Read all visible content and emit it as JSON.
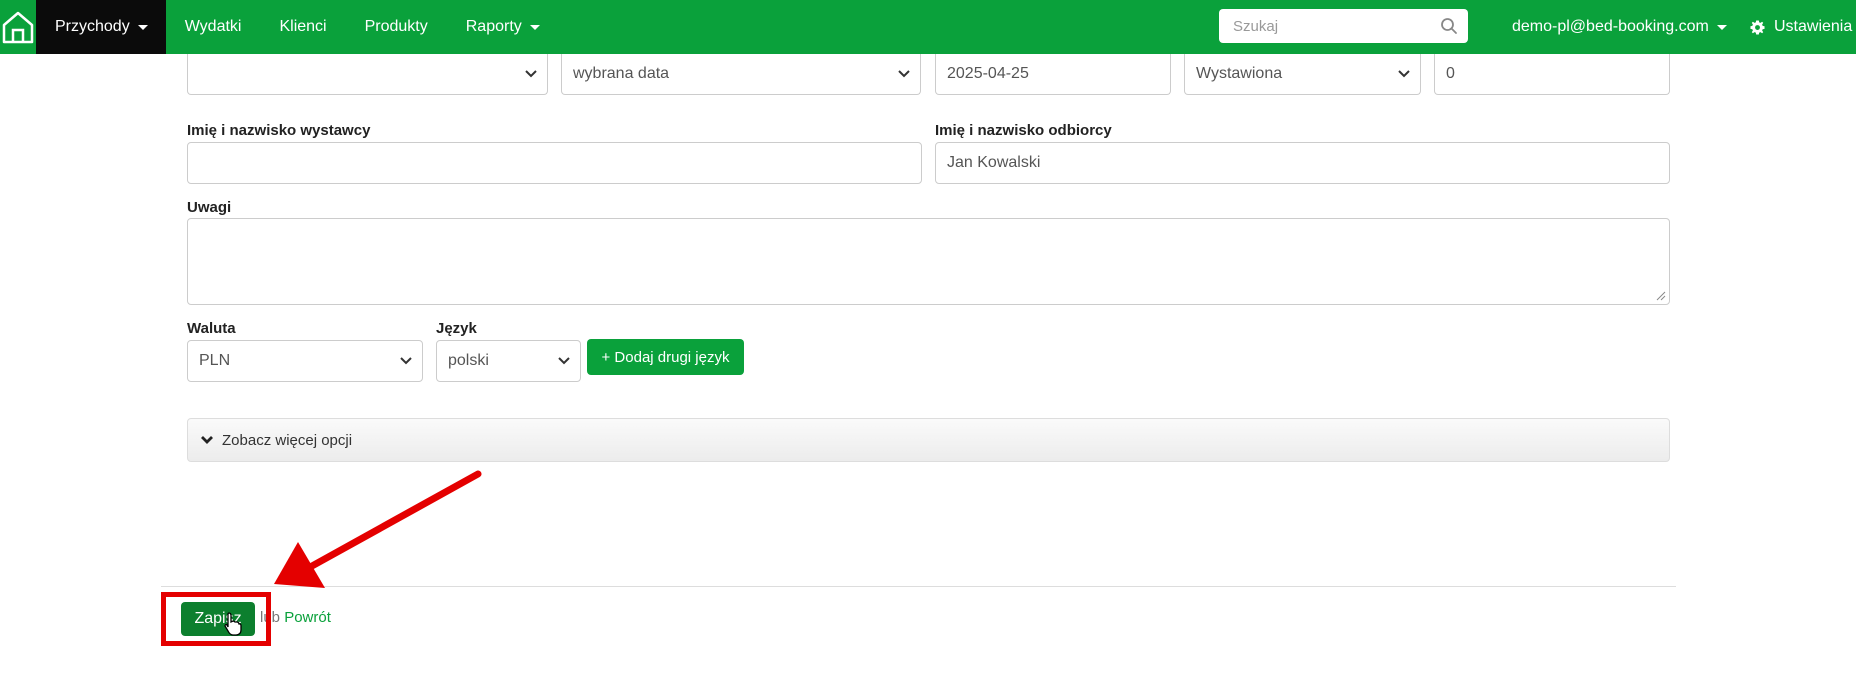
{
  "nav": {
    "items": [
      {
        "label": "Przychody",
        "dropdown": true,
        "active": true
      },
      {
        "label": "Wydatki",
        "dropdown": false,
        "active": false
      },
      {
        "label": "Klienci",
        "dropdown": false,
        "active": false
      },
      {
        "label": "Produkty",
        "dropdown": false,
        "active": false
      },
      {
        "label": "Raporty",
        "dropdown": true,
        "active": false
      }
    ],
    "search_placeholder": "Szukaj",
    "user_email": "demo-pl@bed-booking.com",
    "settings_label": "Ustawienia"
  },
  "form": {
    "row1": {
      "select1_value": "",
      "date_type_value": "wybrana data",
      "date_value": "2025-04-25",
      "status_value": "Wystawiona",
      "number_value": "0"
    },
    "issuer_label": "Imię i nazwisko wystawcy",
    "issuer_value": "",
    "recipient_label": "Imię i nazwisko odbiorcy",
    "recipient_value": "Jan Kowalski",
    "notes_label": "Uwagi",
    "notes_value": "",
    "currency_label": "Waluta",
    "currency_value": "PLN",
    "language_label": "Język",
    "language_value": "polski",
    "add_language_button": "+ Dodaj drugi język",
    "more_options_label": "Zobacz więcej opcji"
  },
  "footer": {
    "save_label": "Zapisz",
    "or_text": "lub",
    "back_label": "Powrót"
  },
  "colors": {
    "brand_green": "#0aa13b",
    "save_green": "#0c7f2e",
    "annotation_red": "#e40000"
  }
}
